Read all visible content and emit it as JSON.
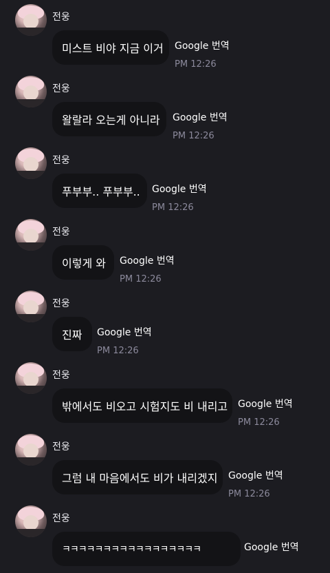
{
  "messages": [
    {
      "sender": "전웅",
      "text": "미스트 비야 지금 이거",
      "translate": "Google 번역",
      "time": "PM 12:26"
    },
    {
      "sender": "전웅",
      "text": "왈랄라 오는게 아니라",
      "translate": "Google 번역",
      "time": "PM 12:26"
    },
    {
      "sender": "전웅",
      "text": "푸부부.. 푸부부..",
      "translate": "Google 번역",
      "time": "PM 12:26"
    },
    {
      "sender": "전웅",
      "text": "이렇게 와",
      "translate": "Google 번역",
      "time": "PM 12:26"
    },
    {
      "sender": "전웅",
      "text": "진짜",
      "translate": "Google 번역",
      "time": "PM 12:26"
    },
    {
      "sender": "전웅",
      "text": "밖에서도 비오고 시험지도 비 내리고",
      "translate": "Google 번역",
      "time": "PM 12:26"
    },
    {
      "sender": "전웅",
      "text": "그럼 내 마음에서도 비가 내리겠지",
      "translate": "Google 번역",
      "time": "PM 12:26"
    },
    {
      "sender": "전웅",
      "text": "ㅋㅋㅋㅋㅋㅋㅋㅋㅋㅋㅋㅋㅋㅋㅋㅋㅋ",
      "translate": "Google 번역",
      "time": ""
    }
  ]
}
